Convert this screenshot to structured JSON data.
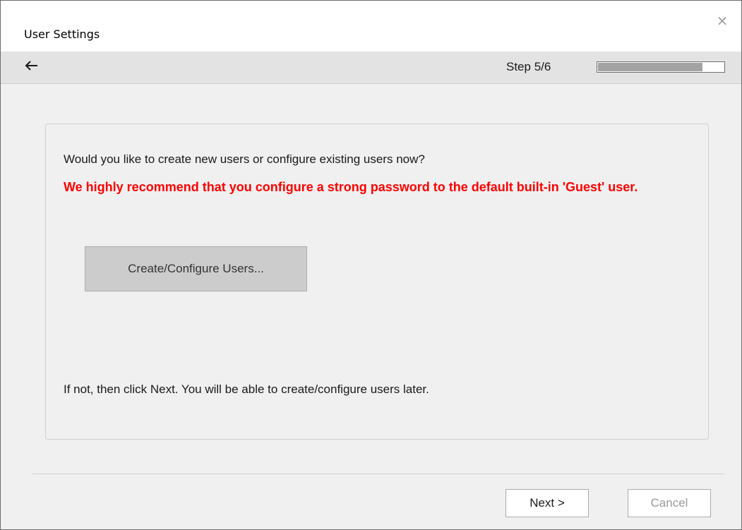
{
  "window": {
    "title": "User Settings",
    "close_icon": "×"
  },
  "navbar": {
    "back_icon": "arrow-left-icon",
    "step_label": "Step 5/6",
    "progress": 0.83
  },
  "main": {
    "question": "Would you like to create new users or configure existing users now?",
    "warning": "We highly recommend that you configure a strong password to the default built-in 'Guest' user.",
    "create_button_label": "Create/Configure Users...",
    "later_text": "If not, then click Next. You will be able to create/configure users later."
  },
  "footer": {
    "next_label": "Next >",
    "cancel_label": "Cancel"
  },
  "colors": {
    "warning": "#ff0000",
    "progress_fill": "#a3a3a3",
    "button_face": "#cccccc"
  }
}
